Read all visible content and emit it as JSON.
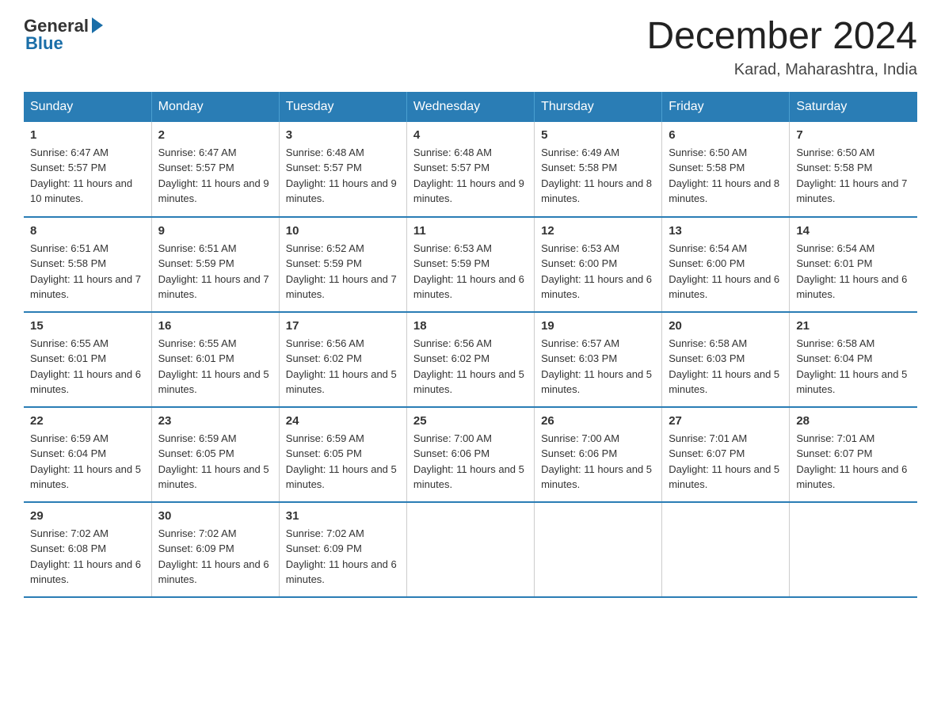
{
  "logo": {
    "general": "General",
    "blue": "Blue"
  },
  "title": "December 2024",
  "subtitle": "Karad, Maharashtra, India",
  "days_header": [
    "Sunday",
    "Monday",
    "Tuesday",
    "Wednesday",
    "Thursday",
    "Friday",
    "Saturday"
  ],
  "weeks": [
    [
      {
        "num": "1",
        "sunrise": "6:47 AM",
        "sunset": "5:57 PM",
        "daylight": "11 hours and 10 minutes."
      },
      {
        "num": "2",
        "sunrise": "6:47 AM",
        "sunset": "5:57 PM",
        "daylight": "11 hours and 9 minutes."
      },
      {
        "num": "3",
        "sunrise": "6:48 AM",
        "sunset": "5:57 PM",
        "daylight": "11 hours and 9 minutes."
      },
      {
        "num": "4",
        "sunrise": "6:48 AM",
        "sunset": "5:57 PM",
        "daylight": "11 hours and 9 minutes."
      },
      {
        "num": "5",
        "sunrise": "6:49 AM",
        "sunset": "5:58 PM",
        "daylight": "11 hours and 8 minutes."
      },
      {
        "num": "6",
        "sunrise": "6:50 AM",
        "sunset": "5:58 PM",
        "daylight": "11 hours and 8 minutes."
      },
      {
        "num": "7",
        "sunrise": "6:50 AM",
        "sunset": "5:58 PM",
        "daylight": "11 hours and 7 minutes."
      }
    ],
    [
      {
        "num": "8",
        "sunrise": "6:51 AM",
        "sunset": "5:58 PM",
        "daylight": "11 hours and 7 minutes."
      },
      {
        "num": "9",
        "sunrise": "6:51 AM",
        "sunset": "5:59 PM",
        "daylight": "11 hours and 7 minutes."
      },
      {
        "num": "10",
        "sunrise": "6:52 AM",
        "sunset": "5:59 PM",
        "daylight": "11 hours and 7 minutes."
      },
      {
        "num": "11",
        "sunrise": "6:53 AM",
        "sunset": "5:59 PM",
        "daylight": "11 hours and 6 minutes."
      },
      {
        "num": "12",
        "sunrise": "6:53 AM",
        "sunset": "6:00 PM",
        "daylight": "11 hours and 6 minutes."
      },
      {
        "num": "13",
        "sunrise": "6:54 AM",
        "sunset": "6:00 PM",
        "daylight": "11 hours and 6 minutes."
      },
      {
        "num": "14",
        "sunrise": "6:54 AM",
        "sunset": "6:01 PM",
        "daylight": "11 hours and 6 minutes."
      }
    ],
    [
      {
        "num": "15",
        "sunrise": "6:55 AM",
        "sunset": "6:01 PM",
        "daylight": "11 hours and 6 minutes."
      },
      {
        "num": "16",
        "sunrise": "6:55 AM",
        "sunset": "6:01 PM",
        "daylight": "11 hours and 5 minutes."
      },
      {
        "num": "17",
        "sunrise": "6:56 AM",
        "sunset": "6:02 PM",
        "daylight": "11 hours and 5 minutes."
      },
      {
        "num": "18",
        "sunrise": "6:56 AM",
        "sunset": "6:02 PM",
        "daylight": "11 hours and 5 minutes."
      },
      {
        "num": "19",
        "sunrise": "6:57 AM",
        "sunset": "6:03 PM",
        "daylight": "11 hours and 5 minutes."
      },
      {
        "num": "20",
        "sunrise": "6:58 AM",
        "sunset": "6:03 PM",
        "daylight": "11 hours and 5 minutes."
      },
      {
        "num": "21",
        "sunrise": "6:58 AM",
        "sunset": "6:04 PM",
        "daylight": "11 hours and 5 minutes."
      }
    ],
    [
      {
        "num": "22",
        "sunrise": "6:59 AM",
        "sunset": "6:04 PM",
        "daylight": "11 hours and 5 minutes."
      },
      {
        "num": "23",
        "sunrise": "6:59 AM",
        "sunset": "6:05 PM",
        "daylight": "11 hours and 5 minutes."
      },
      {
        "num": "24",
        "sunrise": "6:59 AM",
        "sunset": "6:05 PM",
        "daylight": "11 hours and 5 minutes."
      },
      {
        "num": "25",
        "sunrise": "7:00 AM",
        "sunset": "6:06 PM",
        "daylight": "11 hours and 5 minutes."
      },
      {
        "num": "26",
        "sunrise": "7:00 AM",
        "sunset": "6:06 PM",
        "daylight": "11 hours and 5 minutes."
      },
      {
        "num": "27",
        "sunrise": "7:01 AM",
        "sunset": "6:07 PM",
        "daylight": "11 hours and 5 minutes."
      },
      {
        "num": "28",
        "sunrise": "7:01 AM",
        "sunset": "6:07 PM",
        "daylight": "11 hours and 6 minutes."
      }
    ],
    [
      {
        "num": "29",
        "sunrise": "7:02 AM",
        "sunset": "6:08 PM",
        "daylight": "11 hours and 6 minutes."
      },
      {
        "num": "30",
        "sunrise": "7:02 AM",
        "sunset": "6:09 PM",
        "daylight": "11 hours and 6 minutes."
      },
      {
        "num": "31",
        "sunrise": "7:02 AM",
        "sunset": "6:09 PM",
        "daylight": "11 hours and 6 minutes."
      },
      null,
      null,
      null,
      null
    ]
  ]
}
